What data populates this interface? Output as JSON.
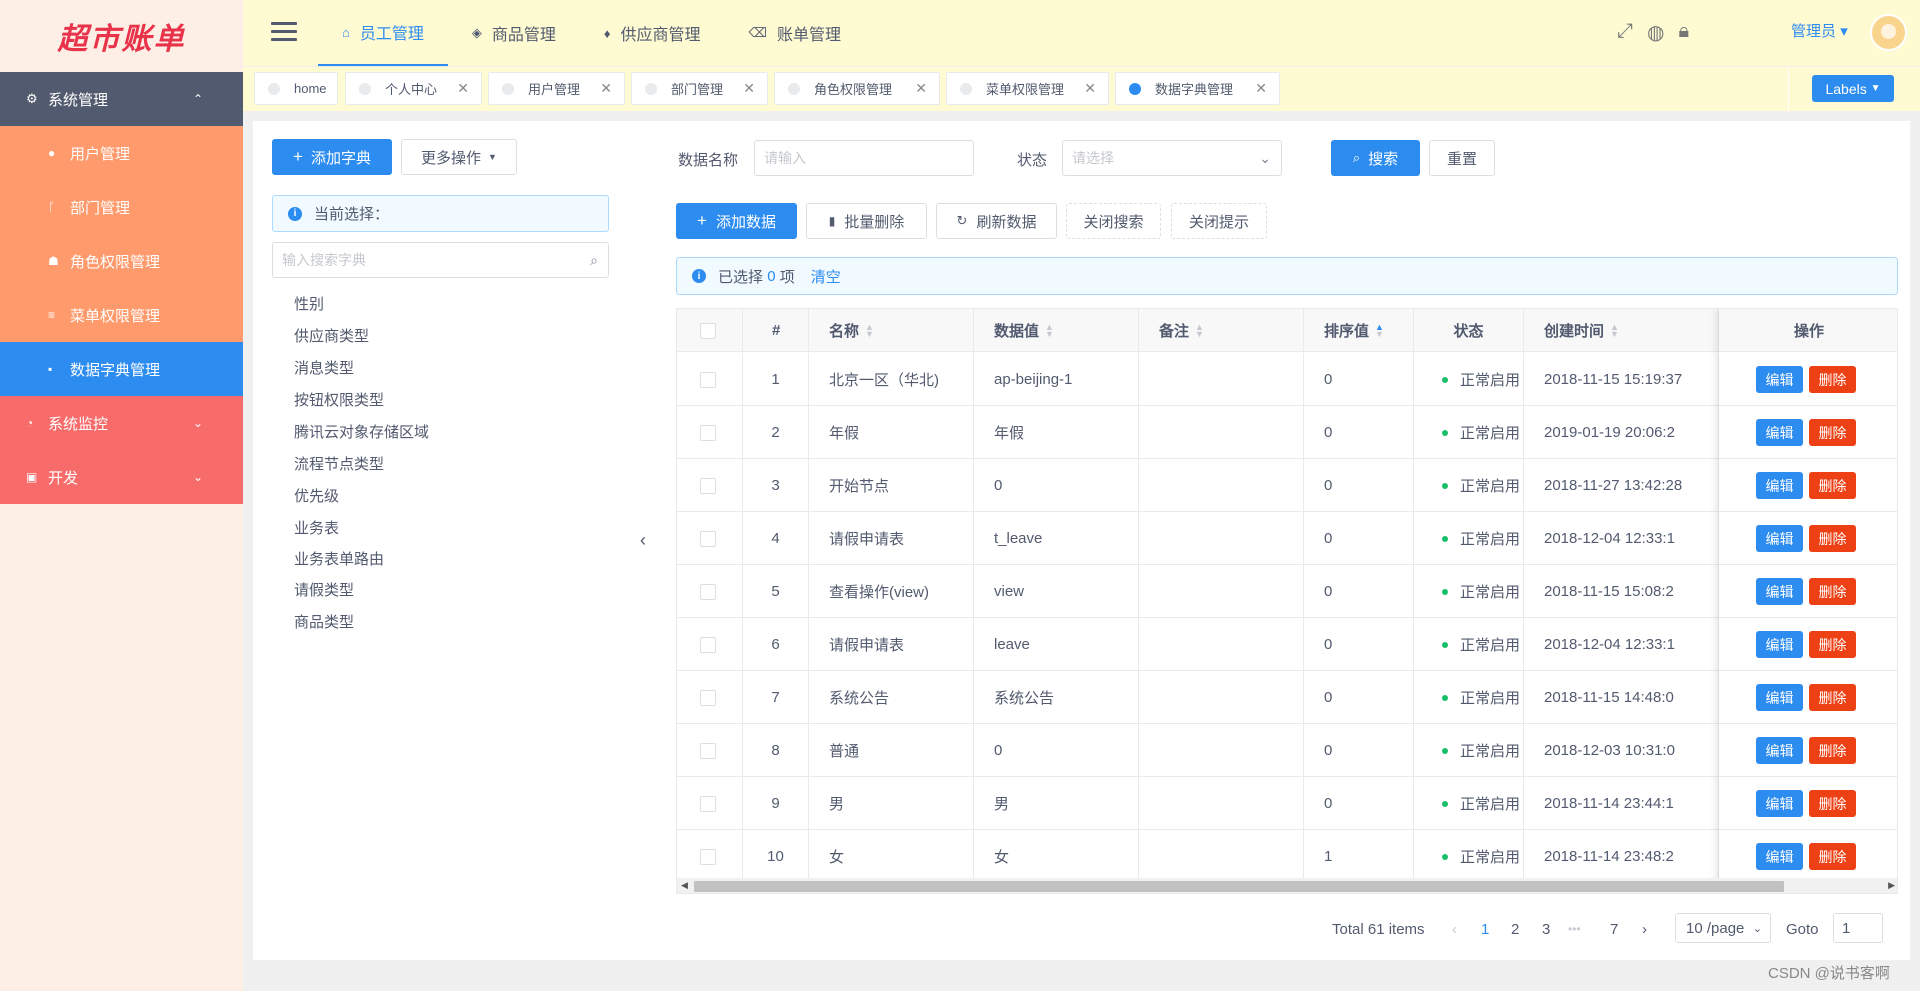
{
  "logo": "超市账单",
  "sidebar": {
    "group": {
      "label": "系统管理",
      "icon": "gear-icon",
      "arrow": "⌃"
    },
    "items": [
      {
        "label": "用户管理",
        "icon": "user-icon"
      },
      {
        "label": "部门管理",
        "icon": "branch-icon"
      },
      {
        "label": "角色权限管理",
        "icon": "group-icon"
      },
      {
        "label": "菜单权限管理",
        "icon": "list-icon"
      },
      {
        "label": "数据字典管理",
        "icon": "book-icon"
      }
    ],
    "groups2": [
      {
        "label": "系统监控",
        "icon": "monitor-icon"
      },
      {
        "label": "开发",
        "icon": "code-icon"
      }
    ]
  },
  "header": {
    "nav": [
      {
        "label": "员工管理",
        "icon": "home-icon"
      },
      {
        "label": "商品管理",
        "icon": "tag-icon"
      },
      {
        "label": "供应商管理",
        "icon": "drop-icon"
      },
      {
        "label": "账单管理",
        "icon": "backspace-icon"
      }
    ],
    "user": "管理员",
    "user_arrow": "▾"
  },
  "tabs": {
    "items": [
      "home",
      "个人中心",
      "用户管理",
      "部门管理",
      "角色权限管理",
      "菜单权限管理",
      "数据字典管理"
    ],
    "labels_button": "Labels"
  },
  "left": {
    "add_dict": "添加字典",
    "more_ops": "更多操作",
    "current_selection": "当前选择：",
    "search_placeholder": "输入搜索字典",
    "tree": [
      "性别",
      "供应商类型",
      "消息类型",
      "按钮权限类型",
      "腾讯云对象存储区域",
      "流程节点类型",
      "优先级",
      "业务表",
      "业务表单路由",
      "请假类型",
      "商品类型"
    ]
  },
  "search": {
    "name_label": "数据名称",
    "name_placeholder": "请输入",
    "status_label": "状态",
    "status_placeholder": "请选择",
    "search_btn": "搜索",
    "reset_btn": "重置"
  },
  "toolbar": {
    "add": "添加数据",
    "batch_delete": "批量删除",
    "refresh": "刷新数据",
    "close_search": "关闭搜索",
    "close_tip": "关闭提示"
  },
  "selection": {
    "prefix": "已选择",
    "count": "0",
    "suffix": "项",
    "clear": "清空"
  },
  "table": {
    "headers": [
      "#",
      "名称",
      "数据值",
      "备注",
      "排序值",
      "状态",
      "创建时间",
      "操作"
    ],
    "edit_label": "编辑",
    "delete_label": "删除",
    "rows": [
      {
        "idx": "1",
        "name": "北京一区（华北)",
        "value": "ap-beijing-1",
        "note": "",
        "sort": "0",
        "status": "正常启用",
        "created": "2018-11-15 15:19:37"
      },
      {
        "idx": "2",
        "name": "年假",
        "value": "年假",
        "note": "",
        "sort": "0",
        "status": "正常启用",
        "created": "2019-01-19 20:06:2"
      },
      {
        "idx": "3",
        "name": "开始节点",
        "value": "0",
        "note": "",
        "sort": "0",
        "status": "正常启用",
        "created": "2018-11-27 13:42:28"
      },
      {
        "idx": "4",
        "name": "请假申请表",
        "value": "t_leave",
        "note": "",
        "sort": "0",
        "status": "正常启用",
        "created": "2018-12-04 12:33:1"
      },
      {
        "idx": "5",
        "name": "查看操作(view)",
        "value": "view",
        "note": "",
        "sort": "0",
        "status": "正常启用",
        "created": "2018-11-15 15:08:2"
      },
      {
        "idx": "6",
        "name": "请假申请表",
        "value": "leave",
        "note": "",
        "sort": "0",
        "status": "正常启用",
        "created": "2018-12-04 12:33:1"
      },
      {
        "idx": "7",
        "name": "系统公告",
        "value": "系统公告",
        "note": "",
        "sort": "0",
        "status": "正常启用",
        "created": "2018-11-15 14:48:0"
      },
      {
        "idx": "8",
        "name": "普通",
        "value": "0",
        "note": "",
        "sort": "0",
        "status": "正常启用",
        "created": "2018-12-03 10:31:0"
      },
      {
        "idx": "9",
        "name": "男",
        "value": "男",
        "note": "",
        "sort": "0",
        "status": "正常启用",
        "created": "2018-11-14 23:44:1"
      },
      {
        "idx": "10",
        "name": "女",
        "value": "女",
        "note": "",
        "sort": "1",
        "status": "正常启用",
        "created": "2018-11-14 23:48:2"
      }
    ]
  },
  "pagination": {
    "total": "Total 61 items",
    "pages": [
      "1",
      "2",
      "3",
      "•••",
      "7"
    ],
    "prev": "‹",
    "next": "›",
    "page_size": "10 /page",
    "goto_label": "Goto",
    "goto_value": "1"
  },
  "watermark": "CSDN @说书客啊"
}
